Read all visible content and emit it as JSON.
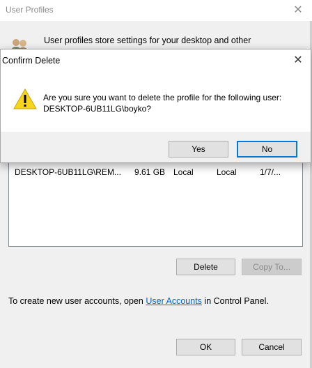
{
  "background": {
    "window_title": "User Profiles",
    "close_glyph": "✕",
    "description": "User profiles store settings for your desktop and other",
    "profile_rows": [
      {
        "name": "DESKTOP-6UB11LG\\REM...",
        "size": "9.61 GB",
        "type": "Local",
        "status": "Local",
        "modified": "1/7/..."
      }
    ],
    "buttons": {
      "delete": "Delete",
      "copy_to": "Copy To...",
      "ok": "OK",
      "cancel": "Cancel"
    },
    "accounts_prefix": "To create new user accounts, open ",
    "accounts_link": "User Accounts",
    "accounts_suffix": " in Control Panel."
  },
  "dialog": {
    "title": "Confirm Delete",
    "close_glyph": "✕",
    "message_line1": "Are you sure you want to delete the profile for the following user:",
    "message_line2": "DESKTOP-6UB11LG\\boyko?",
    "yes_label": "Yes",
    "no_label": "No",
    "icon": "warning-icon"
  },
  "colors": {
    "accent": "#0078d7",
    "warning_fill": "#f7d51d",
    "link": "#0066cc"
  }
}
